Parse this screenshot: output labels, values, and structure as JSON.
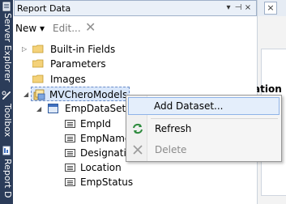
{
  "side_tabs": [
    {
      "label": "Server Explorer",
      "icon": "server-icon"
    },
    {
      "label": "Toolbox",
      "icon": "toolbox-icon"
    },
    {
      "label": "Report D",
      "icon": "report-icon"
    }
  ],
  "window": {
    "title": "Report Data",
    "title_buttons": {
      "dropdown": "▾",
      "pin": "⊣",
      "close": "×"
    }
  },
  "toolbar": {
    "new_label": "New ▾",
    "edit_label": "Edit...",
    "delete_glyph": "✕"
  },
  "tree": {
    "builtin": "Built-in Fields",
    "parameters": "Parameters",
    "images": "Images",
    "datasource": "MVCheroModels",
    "dataset": "EmpDataSet",
    "fields": [
      "EmpId",
      "EmpName",
      "Designation",
      "Location",
      "EmpStatus"
    ]
  },
  "background": {
    "heading_fragment": "ation",
    "close_glyph": "×"
  },
  "context_menu": {
    "add_dataset": "Add Dataset...",
    "refresh": "Refresh",
    "delete": "Delete"
  },
  "colors": {
    "side_strip": "#2b3c59",
    "selection": "#d9e7fb",
    "menu_highlight": "#e4eefb"
  }
}
